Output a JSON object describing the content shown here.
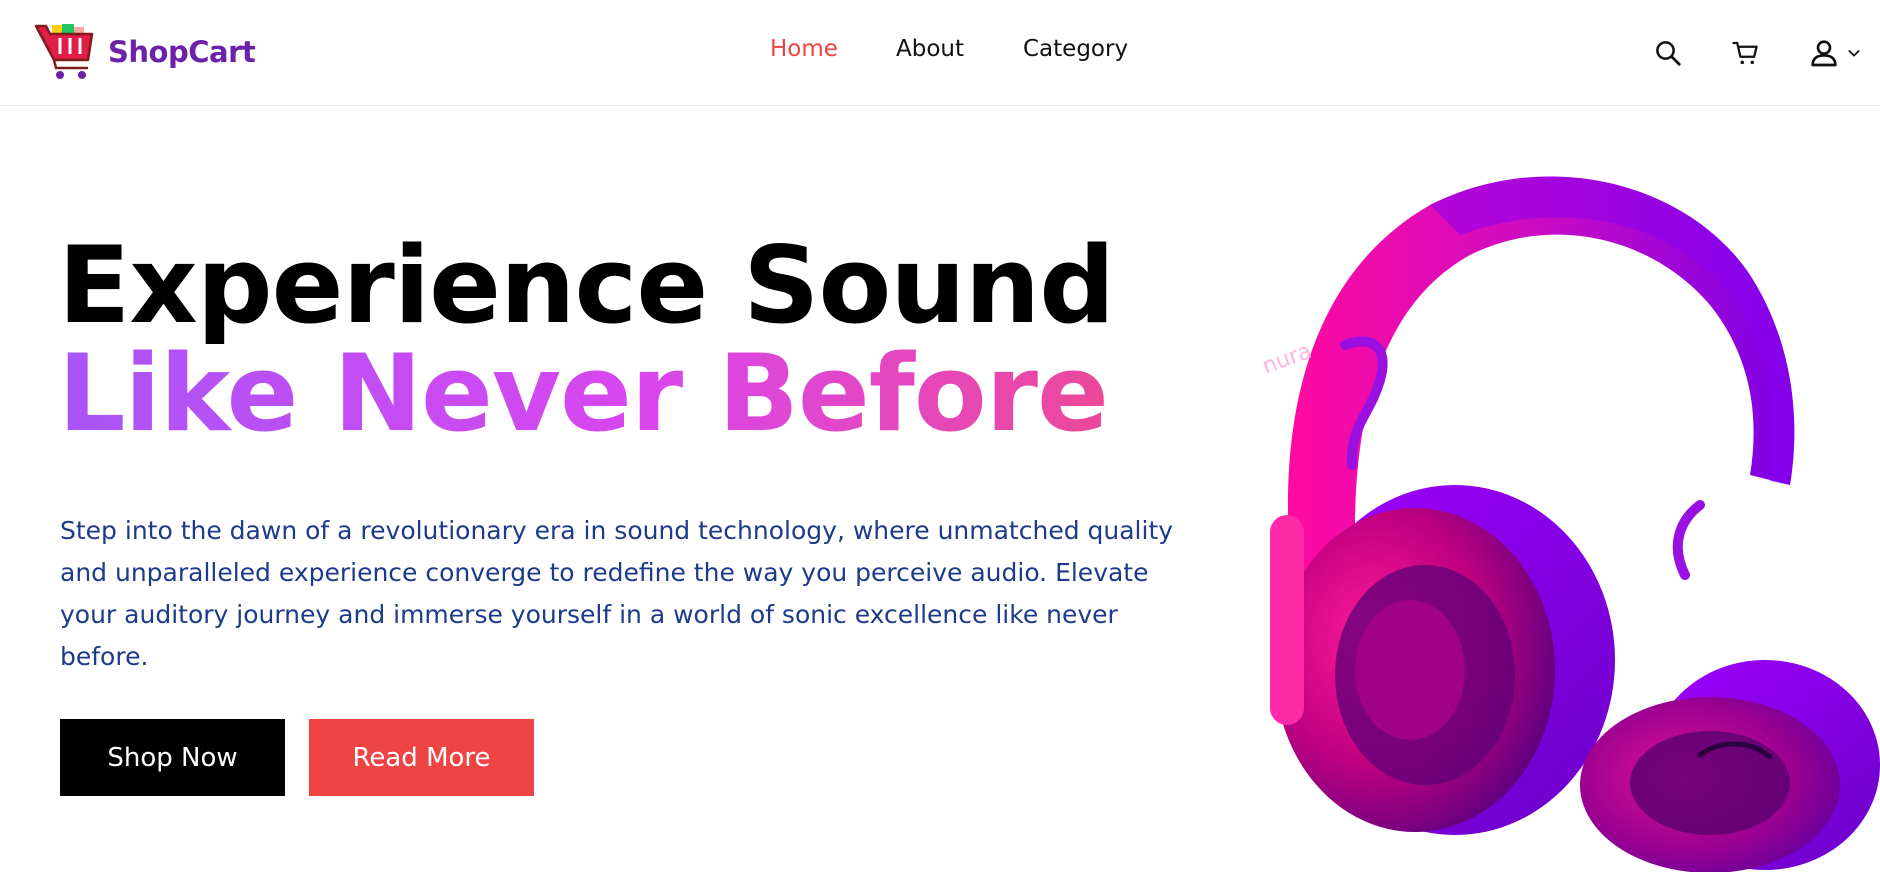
{
  "brand": {
    "name": "ShopCart"
  },
  "nav": {
    "links": [
      {
        "label": "Home"
      },
      {
        "label": "About"
      },
      {
        "label": "Category"
      }
    ],
    "icons": [
      "search-icon",
      "cart-icon",
      "user-icon",
      "chevron-down-icon"
    ]
  },
  "hero": {
    "title_line1": "Experience Sound",
    "title_line2": "Like Never Before",
    "description": "Step into the dawn of a revolutionary era in sound technology, where unmatched quality and unparalleled experience converge to redefine the way you perceive audio. Elevate your auditory journey and immerse yourself in a world of sonic excellence like never before.",
    "primary_button": "Shop Now",
    "secondary_button": "Read More",
    "image_brand_text": "nura"
  },
  "colors": {
    "accent": "#ef4444",
    "brand": "#6b21a8",
    "description_text": "#1e3a8a",
    "gradient_start": "#a855f7",
    "gradient_end": "#ec4899"
  }
}
